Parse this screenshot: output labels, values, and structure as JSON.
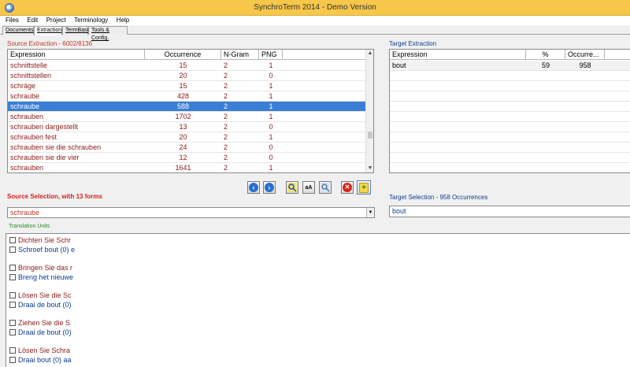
{
  "window": {
    "title": "SynchroTerm 2014 - Demo Version"
  },
  "menu": [
    "Files",
    "Edit",
    "Project",
    "Terminology",
    "Help"
  ],
  "tabs": [
    "Documents",
    "Extraction",
    "TermBase",
    "Tools & Config."
  ],
  "active_tab": "Extraction",
  "source_extraction": {
    "label": "Source Extraction - 6002/8136",
    "columns": [
      "Expression",
      "Occurrence",
      "N-Gram",
      "PNG"
    ],
    "rows": [
      [
        "schnittstelle",
        "15",
        "2",
        "1"
      ],
      [
        "schnittstellen",
        "20",
        "2",
        "0"
      ],
      [
        "schräge",
        "15",
        "2",
        "1"
      ],
      [
        "schraube",
        "428",
        "2",
        "1"
      ],
      [
        "schraube",
        "588",
        "2",
        "1"
      ],
      [
        "schrauben",
        "1702",
        "2",
        "1"
      ],
      [
        "schrauben dargestellt",
        "13",
        "2",
        "0"
      ],
      [
        "schrauben fest",
        "20",
        "2",
        "1"
      ],
      [
        "schrauben sie die schrauben",
        "24",
        "2",
        "0"
      ],
      [
        "schrauben sie die vier",
        "12",
        "2",
        "0"
      ],
      [
        "schrauben",
        "1641",
        "2",
        "1"
      ]
    ],
    "selected_index": 4
  },
  "target_extraction": {
    "label": "Target Extraction",
    "columns": [
      "Expression",
      "%",
      "Occurre..."
    ],
    "rows": [
      [
        "bout",
        "59",
        "958"
      ]
    ]
  },
  "toolbar": {
    "icons": [
      "back-arrow-icon",
      "forward-arrow-icon",
      "zoom-icon",
      "case-icon",
      "search-icon",
      "delete-icon",
      "add-term-icon"
    ],
    "case_glyph": "aA",
    "delete_glyph": "✕",
    "add_glyph": "+"
  },
  "source_selection": {
    "label": "Source Selection, with 13 forms",
    "value": "schraube"
  },
  "target_selection": {
    "label": "Target Selection - 958 Occurrences",
    "value": "bout"
  },
  "translation_units": {
    "label": "Translation Units",
    "items": [
      {
        "source": "Dichten Sie Schr",
        "target": "Schroef bout (0) e"
      },
      {
        "source": "Bringen Sie das r",
        "target": "Breng het nieuwe"
      },
      {
        "source": "Lösen Sie die Sc",
        "target": "Draai de bout (0)"
      },
      {
        "source": "Ziehen Sie die S",
        "target": "Draai de bout (0)"
      },
      {
        "source": "Lösen Sie Schra",
        "target": "Draai bout (0) aa"
      }
    ]
  },
  "colors": {
    "titlebar": "#f7c74a",
    "selection": "#3a7fd5",
    "source_text": "#8b1a1a",
    "target_text": "#0b3d91"
  }
}
